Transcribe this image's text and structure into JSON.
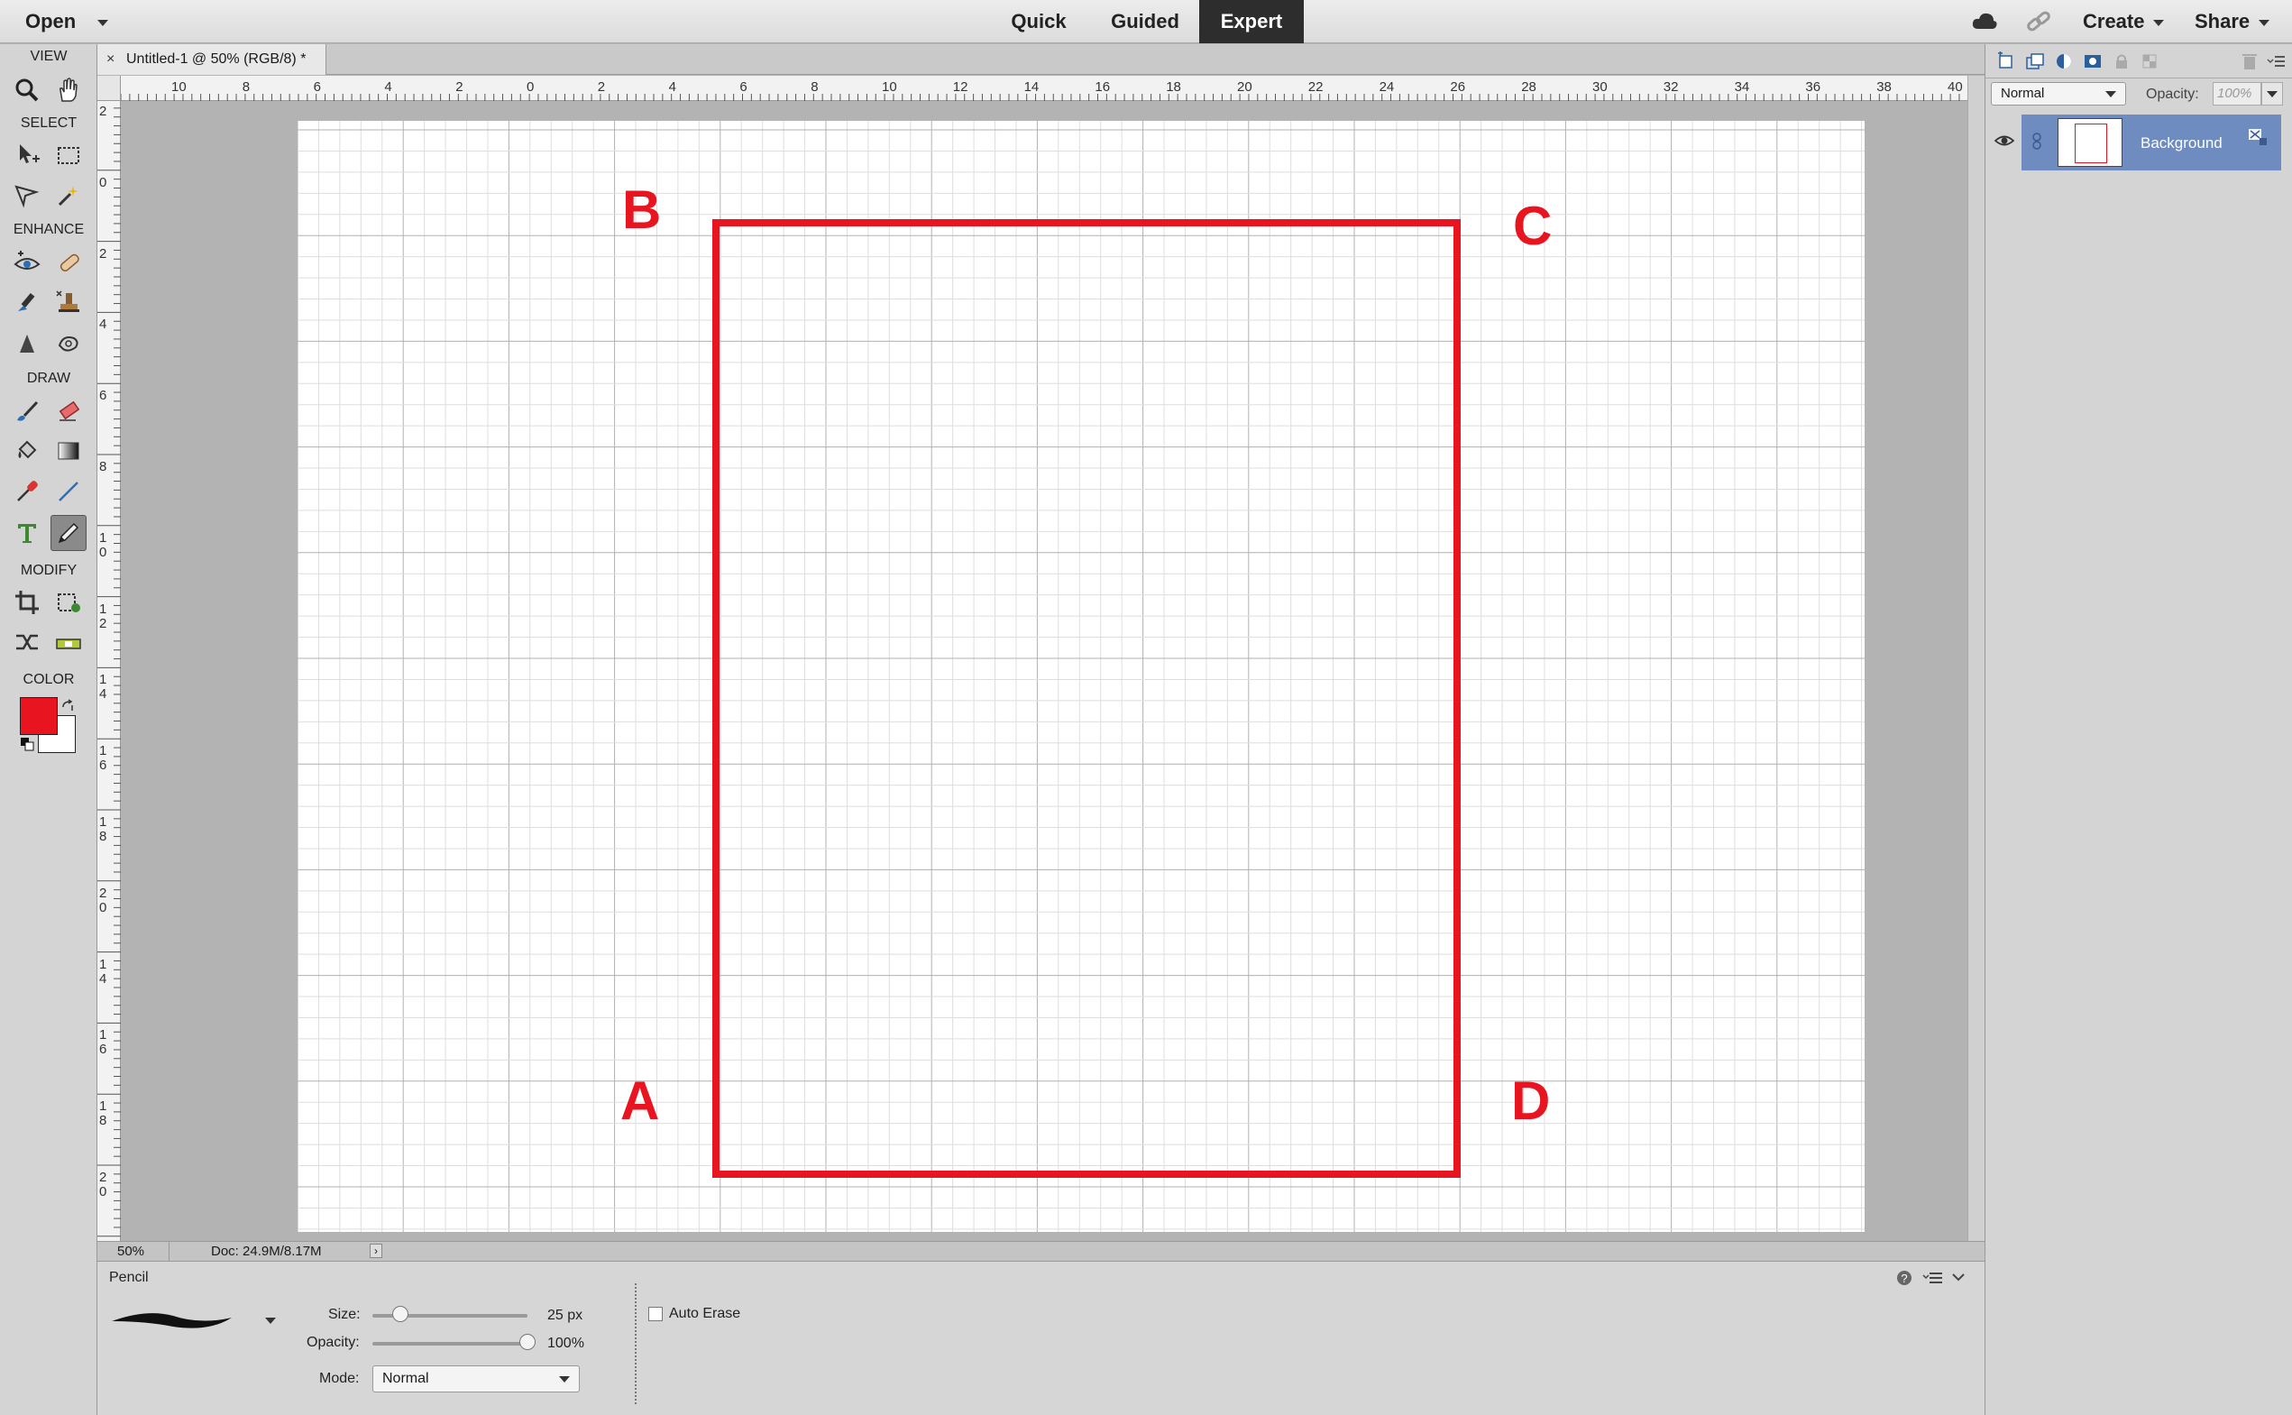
{
  "topbar": {
    "open_label": "Open",
    "mode_tabs": [
      "Quick",
      "Guided",
      "Expert"
    ],
    "active_mode": "Expert",
    "create_label": "Create",
    "share_label": "Share"
  },
  "toolbox": {
    "sections": [
      "VIEW",
      "SELECT",
      "ENHANCE",
      "DRAW",
      "MODIFY",
      "COLOR"
    ],
    "active_tool": "pencil-tool",
    "foreground_color": "#e8141f",
    "background_color": "#ffffff"
  },
  "document": {
    "tab_title": "Untitled-1 @ 50% (RGB/8) *",
    "ruler_h_labels": [
      "10",
      "8",
      "6",
      "4",
      "2",
      "0",
      "2",
      "4",
      "6",
      "8",
      "10",
      "12",
      "14",
      "16",
      "18",
      "20",
      "22",
      "24",
      "26",
      "28",
      "30",
      "32",
      "34",
      "36",
      "38",
      "40"
    ],
    "ruler_v_labels": [
      "2",
      "0",
      "2",
      "4",
      "6",
      "8",
      "10",
      "12",
      "14",
      "16",
      "18",
      "20",
      "14",
      "16",
      "18",
      "20"
    ],
    "corner_labels": {
      "top_left": "B",
      "top_right": "C",
      "bottom_left": "A",
      "bottom_right": "D"
    },
    "rect_color": "#e8141f"
  },
  "status": {
    "zoom": "50%",
    "doc_size": "Doc: 24.9M/8.17M"
  },
  "options": {
    "tool_name": "Pencil",
    "size_label": "Size:",
    "size_value": "25 px",
    "size_fraction": 0.18,
    "opacity_label": "Opacity:",
    "opacity_value": "100%",
    "opacity_fraction": 1.0,
    "mode_label": "Mode:",
    "mode_value": "Normal",
    "auto_erase_label": "Auto Erase",
    "auto_erase_checked": false
  },
  "layers_panel": {
    "blend_mode": "Normal",
    "opacity_label": "Opacity:",
    "opacity_value": "100%",
    "layers": [
      {
        "name": "Background",
        "selected": true
      }
    ]
  }
}
